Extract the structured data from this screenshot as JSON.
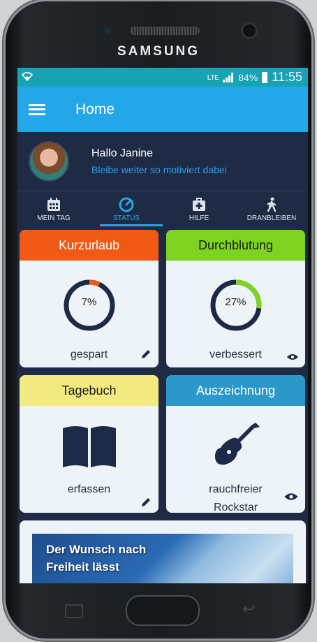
{
  "device": {
    "brand": "SAMSUNG"
  },
  "statusbar": {
    "network": "LTE",
    "battery": "84%",
    "time": "11:55"
  },
  "appbar": {
    "title": "Home"
  },
  "profile": {
    "greeting": "Hallo Janine",
    "subtitle": "Bleibe weiter so motiviert dabei"
  },
  "tabs": [
    {
      "label": "MEIN TAG",
      "icon": "calendar-icon"
    },
    {
      "label": "STATUS",
      "icon": "speedometer-icon",
      "active": true
    },
    {
      "label": "HILFE",
      "icon": "first-aid-icon"
    },
    {
      "label": "DRANBLEIBEN",
      "icon": "walking-person-icon"
    }
  ],
  "cards": {
    "kurzurlaub": {
      "title": "Kurzurlaub",
      "value": "7%",
      "progress": 0.07,
      "footer": "gespart",
      "color": "#f05a14",
      "action_icon": "pencil-icon"
    },
    "durchblutung": {
      "title": "Durchblutung",
      "value": "27%",
      "progress": 0.27,
      "footer": "verbessert",
      "color": "#7ed321",
      "action_icon": "eye-icon"
    },
    "tagebuch": {
      "title": "Tagebuch",
      "footer": "erfassen",
      "color": "#f2ea80",
      "icon": "book-icon",
      "action_icon": "pencil-icon"
    },
    "auszeichnung": {
      "title": "Auszeichnung",
      "footer_line1": "rauchfreier",
      "footer_line2": "Rockstar",
      "color": "#2c97c9",
      "icon": "guitar-icon",
      "action_icon": "eye-icon"
    }
  },
  "banner": {
    "line1": "Der Wunsch nach",
    "line2": "Freiheit lässt"
  }
}
